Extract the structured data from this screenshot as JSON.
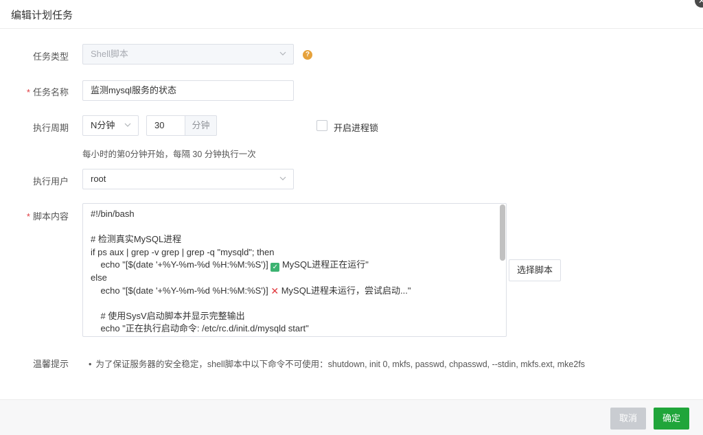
{
  "dialog": {
    "title": "编辑计划任务",
    "close_icon": "close-icon"
  },
  "form": {
    "task_type": {
      "label": "任务类型",
      "value": "Shell脚本",
      "disabled": true
    },
    "task_name": {
      "label": "任务名称",
      "required": true,
      "value": "监测mysql服务的状态"
    },
    "cycle": {
      "label": "执行周期",
      "unit_select": "N分钟",
      "number": "30",
      "number_suffix": "分钟",
      "process_lock_label": "开启进程锁",
      "process_lock_checked": false,
      "hint": "每小时的第0分钟开始，每隔 30 分钟执行一次"
    },
    "user": {
      "label": "执行用户",
      "value": "root"
    },
    "script": {
      "label": "脚本内容",
      "required": true,
      "choose_button": "选择脚本",
      "lines": {
        "l1": "#!/bin/bash",
        "l2": "",
        "l3": "# 检测真实MySQL进程",
        "l4": "if ps aux | grep -v grep | grep -q \"mysqld\"; then",
        "l5a": "    echo \"[$(date '+%Y-%m-%d %H:%M:%S')] ",
        "l5b": " MySQL进程正在运行\"",
        "l6": "else",
        "l7a": "    echo \"[$(date '+%Y-%m-%d %H:%M:%S')] ",
        "l7b": " MySQL进程未运行，尝试启动...\"",
        "l8": "",
        "l9": "    # 使用SysV启动脚本并显示完整输出",
        "l10": "    echo \"正在执行启动命令: /etc/rc.d/init.d/mysqld start\""
      }
    },
    "tip": {
      "label": "温馨提示",
      "bullet": "•",
      "text": "为了保证服务器的安全稳定，shell脚本中以下命令不可使用：shutdown, init 0, mkfs, passwd, chpasswd, --stdin, mkfs.ext, mke2fs"
    }
  },
  "footer": {
    "cancel": "取消",
    "confirm": "确定"
  },
  "colors": {
    "primary": "#20a53a",
    "required": "#e0393e",
    "help": "#e6a23c"
  }
}
